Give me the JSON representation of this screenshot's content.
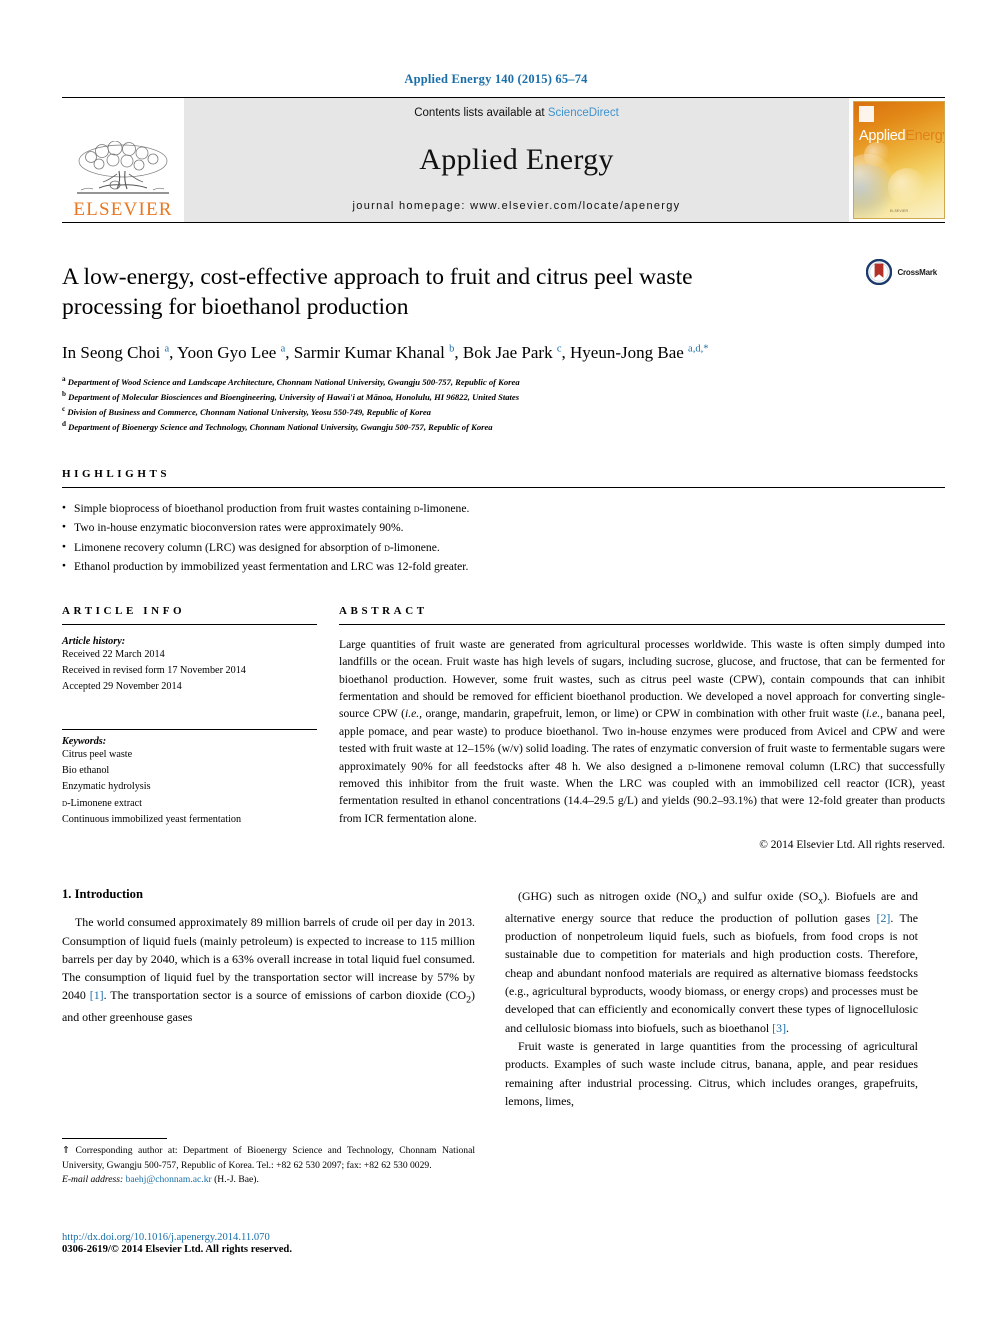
{
  "journal_ref": "Applied Energy 140 (2015) 65–74",
  "masthead": {
    "publisher": "ELSEVIER",
    "contents_prefix": "Contents lists available at",
    "contents_link": "ScienceDirect",
    "journal_name": "Applied Energy",
    "homepage_label": "journal homepage: www.elsevier.com/locate/apenergy",
    "cover": {
      "title_part1": "Applied",
      "title_part2": "Energy",
      "footer_text": "ELSEVIER"
    }
  },
  "article": {
    "title": "A low-energy, cost-effective approach to fruit and citrus peel waste processing for bioethanol production",
    "crossmark_label": "CrossMark",
    "authors_html": "In Seong Choi <sup>a</sup>, Yoon Gyo Lee <sup>a</sup>, Sarmir Kumar Khanal <sup>b</sup>, Bok Jae Park <sup>c</sup>, Hyeun-Jong Bae <sup>a,d,</sup><sup>*</sup>",
    "affiliations": [
      {
        "marker": "a",
        "text": "Department of Wood Science and Landscape Architecture, Chonnam National University, Gwangju 500-757, Republic of Korea"
      },
      {
        "marker": "b",
        "text": "Department of Molecular Biosciences and Bioengineering, University of Hawai'i at Mānoa, Honolulu, HI 96822, United States"
      },
      {
        "marker": "c",
        "text": "Division of Business and Commerce, Chonnam National University, Yeosu 550-749, Republic of Korea"
      },
      {
        "marker": "d",
        "text": "Department of Bioenergy Science and Technology, Chonnam National University, Gwangju 500-757, Republic of Korea"
      }
    ]
  },
  "highlights": {
    "heading": "HIGHLIGHTS",
    "items": [
      "Simple bioprocess of bioethanol production from fruit wastes containing D-limonene.",
      "Two in-house enzymatic bioconversion rates were approximately 90%.",
      "Limonene recovery column (LRC) was designed for absorption of D-limonene.",
      "Ethanol production by immobilized yeast fermentation and LRC was 12-fold greater."
    ]
  },
  "article_info": {
    "heading": "ARTICLE INFO",
    "history_label": "Article history:",
    "history": [
      "Received 22 March 2014",
      "Received in revised form 17 November 2014",
      "Accepted 29 November 2014"
    ],
    "keywords_label": "Keywords:",
    "keywords": [
      "Citrus peel waste",
      "Bio ethanol",
      "Enzymatic hydrolysis",
      "D-Limonene extract",
      "Continuous immobilized yeast fermentation"
    ]
  },
  "abstract": {
    "heading": "ABSTRACT",
    "text": "Large quantities of fruit waste are generated from agricultural processes worldwide. This waste is often simply dumped into landfills or the ocean. Fruit waste has high levels of sugars, including sucrose, glucose, and fructose, that can be fermented for bioethanol production. However, some fruit wastes, such as citrus peel waste (CPW), contain compounds that can inhibit fermentation and should be removed for efficient bioethanol production. We developed a novel approach for converting single-source CPW (i.e., orange, mandarin, grapefruit, lemon, or lime) or CPW in combination with other fruit waste (i.e., banana peel, apple pomace, and pear waste) to produce bioethanol. Two in-house enzymes were produced from Avicel and CPW and were tested with fruit waste at 12–15% (w/v) solid loading. The rates of enzymatic conversion of fruit waste to fermentable sugars were approximately 90% for all feedstocks after 48 h. We also designed a D-limonene removal column (LRC) that successfully removed this inhibitor from the fruit waste. When the LRC was coupled with an immobilized cell reactor (ICR), yeast fermentation resulted in ethanol concentrations (14.4–29.5 g/L) and yields (90.2–93.1%) that were 12-fold greater than products from ICR fermentation alone.",
    "copyright": "© 2014 Elsevier Ltd. All rights reserved."
  },
  "introduction": {
    "heading": "1. Introduction",
    "left_paragraph": "The world consumed approximately 89 million barrels of crude oil per day in 2013. Consumption of liquid fuels (mainly petroleum) is expected to increase to 115 million barrels per day by 2040, which is a 63% overall increase in total liquid fuel consumed. The consumption of liquid fuel by the transportation sector will increase by 57% by 2040 [1]. The transportation sector is a source of emissions of carbon dioxide (CO2) and other greenhouse gases",
    "right_paragraph_1": "(GHG) such as nitrogen oxide (NOx) and sulfur oxide (SOx). Biofuels are and alternative energy source that reduce the production of pollution gases [2]. The production of nonpetroleum liquid fuels, such as biofuels, from food crops is not sustainable due to competition for materials and high production costs. Therefore, cheap and abundant nonfood materials are required as alternative biomass feedstocks (e.g., agricultural byproducts, woody biomass, or energy crops) and processes must be developed that can efficiently and economically convert these types of lignocellulosic and cellulosic biomass into biofuels, such as bioethanol [3].",
    "right_paragraph_2": "Fruit waste is generated in large quantities from the processing of agricultural products. Examples of such waste include citrus, banana, apple, and pear residues remaining after industrial processing. Citrus, which includes oranges, grapefruits, lemons, limes,",
    "citations": {
      "c1": "[1]",
      "c2": "[2]",
      "c3": "[3]"
    }
  },
  "footnote": {
    "text": "⇑ Corresponding author at: Department of Bioenergy Science and Technology, Chonnam National University, Gwangju 500-757, Republic of Korea. Tel.: +82 62 530 2097; fax: +82 62 530 0029.",
    "email_label": "E-mail address:",
    "email": "baehj@chonnam.ac.kr",
    "email_suffix": "(H.-J. Bae)."
  },
  "footer": {
    "doi": "http://dx.doi.org/10.1016/j.apenergy.2014.11.070",
    "issn_line": "0306-2619/© 2014 Elsevier Ltd. All rights reserved."
  },
  "colors": {
    "link_blue": "#1a6ea8",
    "sciencedirect_blue": "#3f93cf",
    "elsevier_orange": "#E87722",
    "banner_gray": "#e6e6e6"
  }
}
